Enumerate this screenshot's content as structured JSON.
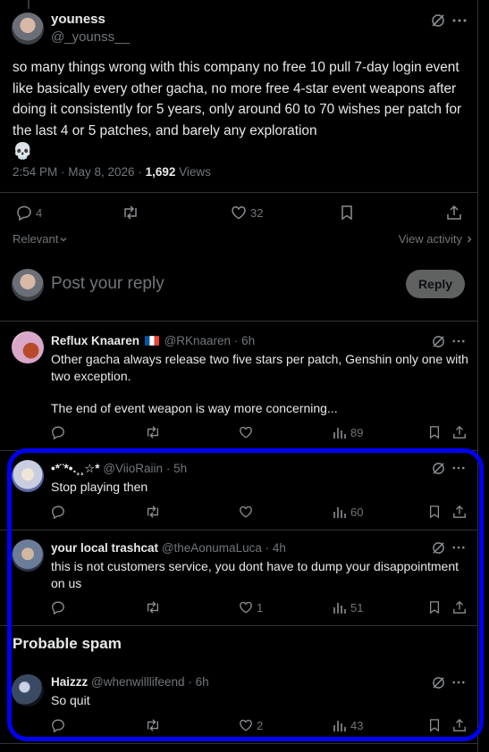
{
  "main_post": {
    "author": "youness",
    "handle": "@_younss__",
    "text": "so many things wrong with this company no free 10 pull 7-day login event like basically every other gacha, no more free 4-star event weapons after doing it consistently for 5 years, only around 60 to 70 wishes per patch for the last 4 or 5 patches, and barely any exploration",
    "emoji": "💀",
    "timestamp": "2:54 PM · May 8, 2026 · ",
    "views_count": "1,692",
    "views_label": " Views",
    "replies_count": "4",
    "likes_count": "32"
  },
  "filters": {
    "relevant_label": "Relevant",
    "view_activity_label": "View activity"
  },
  "compose": {
    "placeholder": "Post your reply",
    "reply_button": "Reply"
  },
  "replies": [
    {
      "author": "Reflux Knaaren",
      "handle": "@RKnaaren",
      "time": "6h",
      "text": "Other gacha always release two five stars per patch, Genshin only one with two exception.",
      "text2": "The end of event weapon is way more concerning...",
      "views": "89",
      "likes": "",
      "avatar_color": "#d9a7c7"
    },
    {
      "author": "•*¨*•.¸¸☆*",
      "handle": "@ViioRaiin",
      "time": "5h",
      "text": "Stop playing then",
      "views": "60",
      "likes": "",
      "avatar_color": "#c8cde0"
    },
    {
      "author": "your local trashcat",
      "handle": "@theAonumaLuca",
      "time": "4h",
      "text": "this is not customers service, you dont have to dump your disappointment on us",
      "views": "51",
      "likes": "1",
      "avatar_color": "#6c7d9a"
    }
  ],
  "spam_section": {
    "title": "Probable spam",
    "reply": {
      "author": "Haizzz",
      "handle": "@whenwilllifeend",
      "time": "6h",
      "text": "So quit",
      "views": "43",
      "likes": "2",
      "avatar_color": "#3a4a63"
    }
  },
  "colors": {
    "background": "#000000",
    "text": "#e7e9ea",
    "muted": "#71767b",
    "divider": "#2f3336",
    "highlight": "#0000f5"
  }
}
